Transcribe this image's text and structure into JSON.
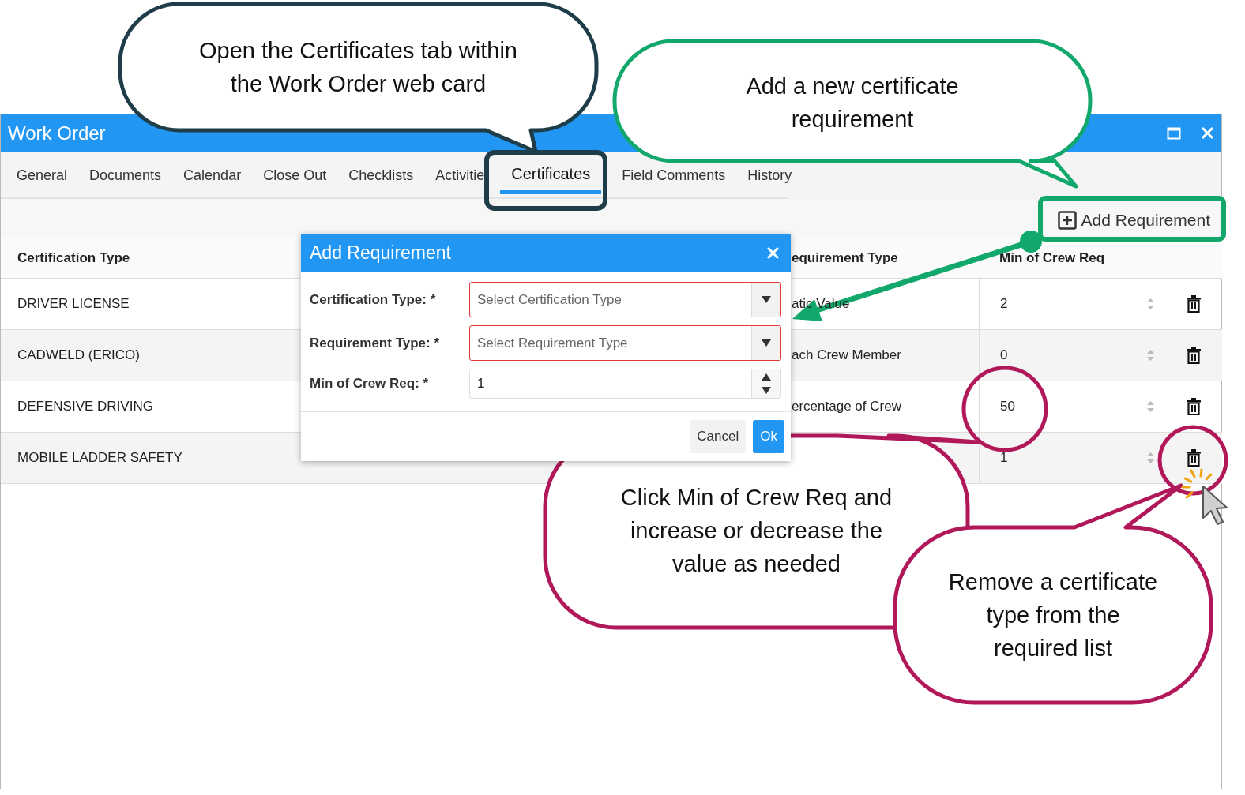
{
  "window": {
    "title": "Work Order"
  },
  "tabs": [
    {
      "label": "General",
      "selected": false
    },
    {
      "label": "Documents",
      "selected": false
    },
    {
      "label": "Calendar",
      "selected": false
    },
    {
      "label": "Close Out",
      "selected": false
    },
    {
      "label": "Checklists",
      "selected": false
    },
    {
      "label": "Activitie",
      "selected": false
    },
    {
      "label": "Certificates",
      "selected": true
    },
    {
      "label": "Field Comments",
      "selected": false
    },
    {
      "label": "History",
      "selected": false
    }
  ],
  "toolbar": {
    "add_button": "Add Requirement"
  },
  "table": {
    "columns": [
      "Certification Type",
      "equirement Type",
      "Min of Crew Req"
    ],
    "rows": [
      {
        "certification_type": "DRIVER LICENSE",
        "column_2": "atic Value",
        "min_of_crew_req": "2"
      },
      {
        "certification_type": "CADWELD (ERICO)",
        "column_2": "ach Crew Member",
        "min_of_crew_req": "0"
      },
      {
        "certification_type": "DEFENSIVE DRIVING",
        "column_2": "ercentage of Crew",
        "min_of_crew_req": "50"
      },
      {
        "certification_type": "MOBILE LADDER SAFETY",
        "min_of_crew_req": "1"
      }
    ]
  },
  "dialog": {
    "title": "Add Requirement",
    "fields": [
      {
        "label": "Certification Type: *",
        "kind": "select",
        "placeholder": "Select Certification Type",
        "invalid": true
      },
      {
        "label": "Requirement Type: *",
        "kind": "select",
        "placeholder": "Select Requirement Type",
        "invalid": true
      },
      {
        "label": "Min of Crew Req: *",
        "kind": "number",
        "value": "1",
        "invalid": false
      }
    ],
    "buttons": [
      {
        "label": "Cancel",
        "kind": "secondary"
      },
      {
        "label": "Ok",
        "kind": "primary"
      }
    ]
  },
  "callouts": [
    {
      "lines": [
        "Open the Certificates tab within",
        "the Work Order web card"
      ],
      "color": "#1e3d48"
    },
    {
      "lines": [
        "Add a new certificate",
        "requirement"
      ],
      "color": "#12a86b"
    },
    {
      "lines": [
        "Click Min of Crew Req and",
        "increase or decrease the",
        "value as needed"
      ],
      "color": "#b0185a"
    },
    {
      "lines": [
        "Remove a certificate",
        "type from the",
        "required list"
      ],
      "color": "#b0185a"
    }
  ]
}
